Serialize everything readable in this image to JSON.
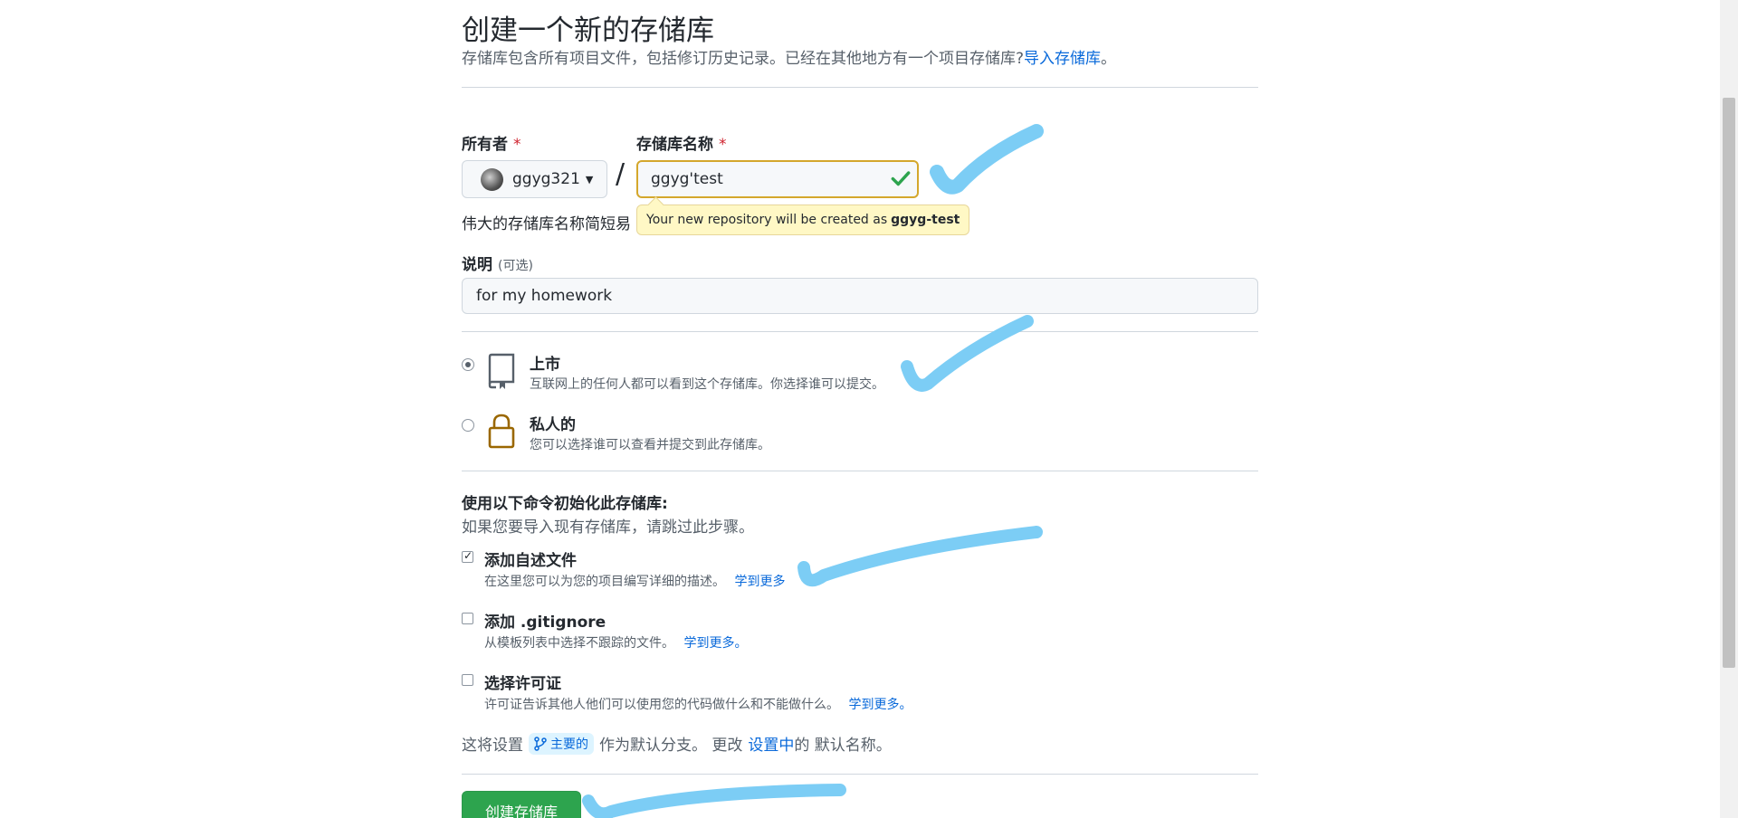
{
  "header": {
    "title": "创建一个新的存储库",
    "subtitle_prefix": "存储库包含所有项目文件，包括修订历史记录。已经在其他地方有一个项目存储库?",
    "import_link": "导入存储库",
    "subtitle_suffix": "。"
  },
  "owner": {
    "label": "所有者",
    "required_mark": "*",
    "value": "ggyg321"
  },
  "repo_name": {
    "label": "存储库名称",
    "required_mark": "*",
    "value": "ggyg'test",
    "hint": "伟大的存储库名称简短易",
    "tooltip_prefix": "Your new repository will be created as",
    "tooltip_name": "ggyg-test"
  },
  "description": {
    "label": "说明",
    "optional": "(可选)",
    "value": "for my homework"
  },
  "visibility": {
    "public": {
      "title": "上市",
      "desc": "互联网上的任何人都可以看到这个存储库。你选择谁可以提交。"
    },
    "private": {
      "title": "私人的",
      "desc": "您可以选择谁可以查看并提交到此存储库。"
    }
  },
  "init": {
    "title": "使用以下命令初始化此存储库:",
    "subtitle": "如果您要导入现有存储库，请跳过此步骤。",
    "readme": {
      "title": "添加自述文件",
      "desc": "在这里您可以为您的项目编写详细的描述。",
      "link": "学到更多"
    },
    "gitignore": {
      "title": "添加 .gitignore",
      "desc": "从模板列表中选择不跟踪的文件。",
      "link": "学到更多。"
    },
    "license": {
      "title": "选择许可证",
      "desc": "许可证告诉其他人他们可以使用您的代码做什么和不能做什么。",
      "link": "学到更多。"
    }
  },
  "branch": {
    "prefix": "这将设置",
    "branch_name": "主要的",
    "middle": "作为默认分支。 更改",
    "settings_link": "设置中",
    "suffix": "的 默认名称。"
  },
  "submit": {
    "label": "创建存储库"
  },
  "colors": {
    "accent": "#0969da",
    "success": "#2da44e",
    "warning_border": "#d4a72c",
    "annotation": "#7ccdf5"
  }
}
